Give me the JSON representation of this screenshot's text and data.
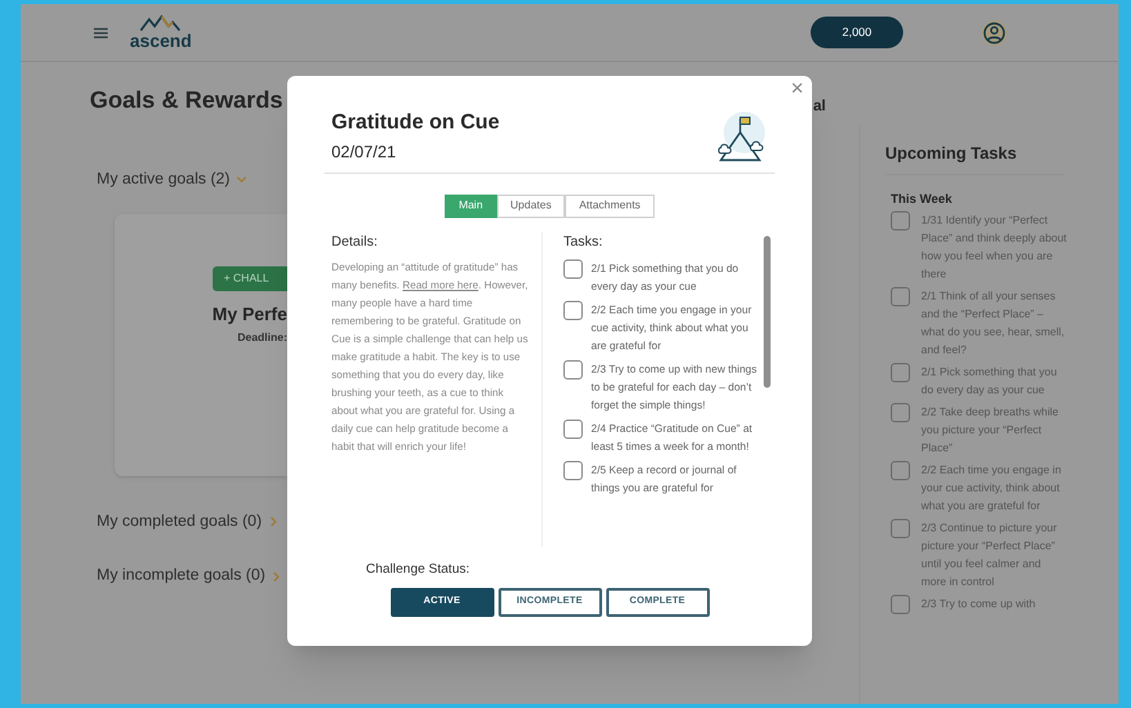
{
  "header": {
    "logo_text": "ascend",
    "points": "2,000"
  },
  "page": {
    "title": "Goals & Rewards",
    "cut_heading": "al",
    "sections": [
      {
        "label": "My active goals (2)",
        "expanded": true
      },
      {
        "label": "My completed goals (0)",
        "expanded": false
      },
      {
        "label": "My incomplete goals (0)",
        "expanded": false
      }
    ],
    "goal_card": {
      "button": "+ CHALL",
      "title": "My Perfe",
      "deadline": "Deadline:"
    }
  },
  "upcoming": {
    "title": "Upcoming Tasks",
    "group": "This Week",
    "tasks": [
      {
        "text": "1/31 Identify your “Perfect Place” and think deeply about how you feel when you are there",
        "checked": false
      },
      {
        "text": "2/1 Think of all your senses and the “Perfect Place” – what do you see, hear, smell, and feel?",
        "checked": false
      },
      {
        "text": "2/1 Pick something that you do every day as your cue",
        "checked": false
      },
      {
        "text": "2/2 Take deep breaths while you picture your “Perfect Place”",
        "checked": false
      },
      {
        "text": "2/2 Each time you engage in your cue activity, think about what you are grateful for",
        "checked": false
      },
      {
        "text": "2/3 Continue to picture your picture your “Perfect Place” until you feel calmer and more in control",
        "checked": false
      },
      {
        "text": "2/3 Try to come up with",
        "checked": false
      }
    ]
  },
  "modal": {
    "title": "Gratitude on Cue",
    "date": "02/07/21",
    "close": "×",
    "tabs": [
      {
        "label": "Main",
        "selected": true
      },
      {
        "label": "Updates",
        "selected": false
      },
      {
        "label": "Attachments",
        "selected": false
      }
    ],
    "details_label": "Details:",
    "details_before": "Developing an “attitude of gratitude” has many benefits. ",
    "details_link": "Read more here",
    "details_after": ". However, many people have a hard time remembering to be grateful. Gratitude on Cue is a simple challenge that can help us make gratitude a habit. The key is to use something that you do every day, like brushing your teeth, as a cue to think about what you are grateful for. Using a daily cue can help gratitude become a habit that will enrich your life!",
    "tasks_label": "Tasks:",
    "tasks": [
      {
        "text": "2/1 Pick something that you do every day as your cue",
        "checked": false
      },
      {
        "text": "2/2 Each time you engage in your cue activity, think about what you are grateful for",
        "checked": false
      },
      {
        "text": "2/3 Try to come up with new things to be grateful for each day – don’t forget the simple things!",
        "checked": false
      },
      {
        "text": "2/4 Practice “Gratitude on Cue” at least 5 times a week for a month!",
        "checked": false
      },
      {
        "text": "2/5 Keep a record or journal of things you are grateful for",
        "checked": false
      }
    ],
    "status_label": "Challenge Status:",
    "status_options": [
      {
        "label": "ACTIVE",
        "selected": true
      },
      {
        "label": "INCOMPLETE",
        "selected": false
      },
      {
        "label": "COMPLETE",
        "selected": false
      }
    ]
  }
}
